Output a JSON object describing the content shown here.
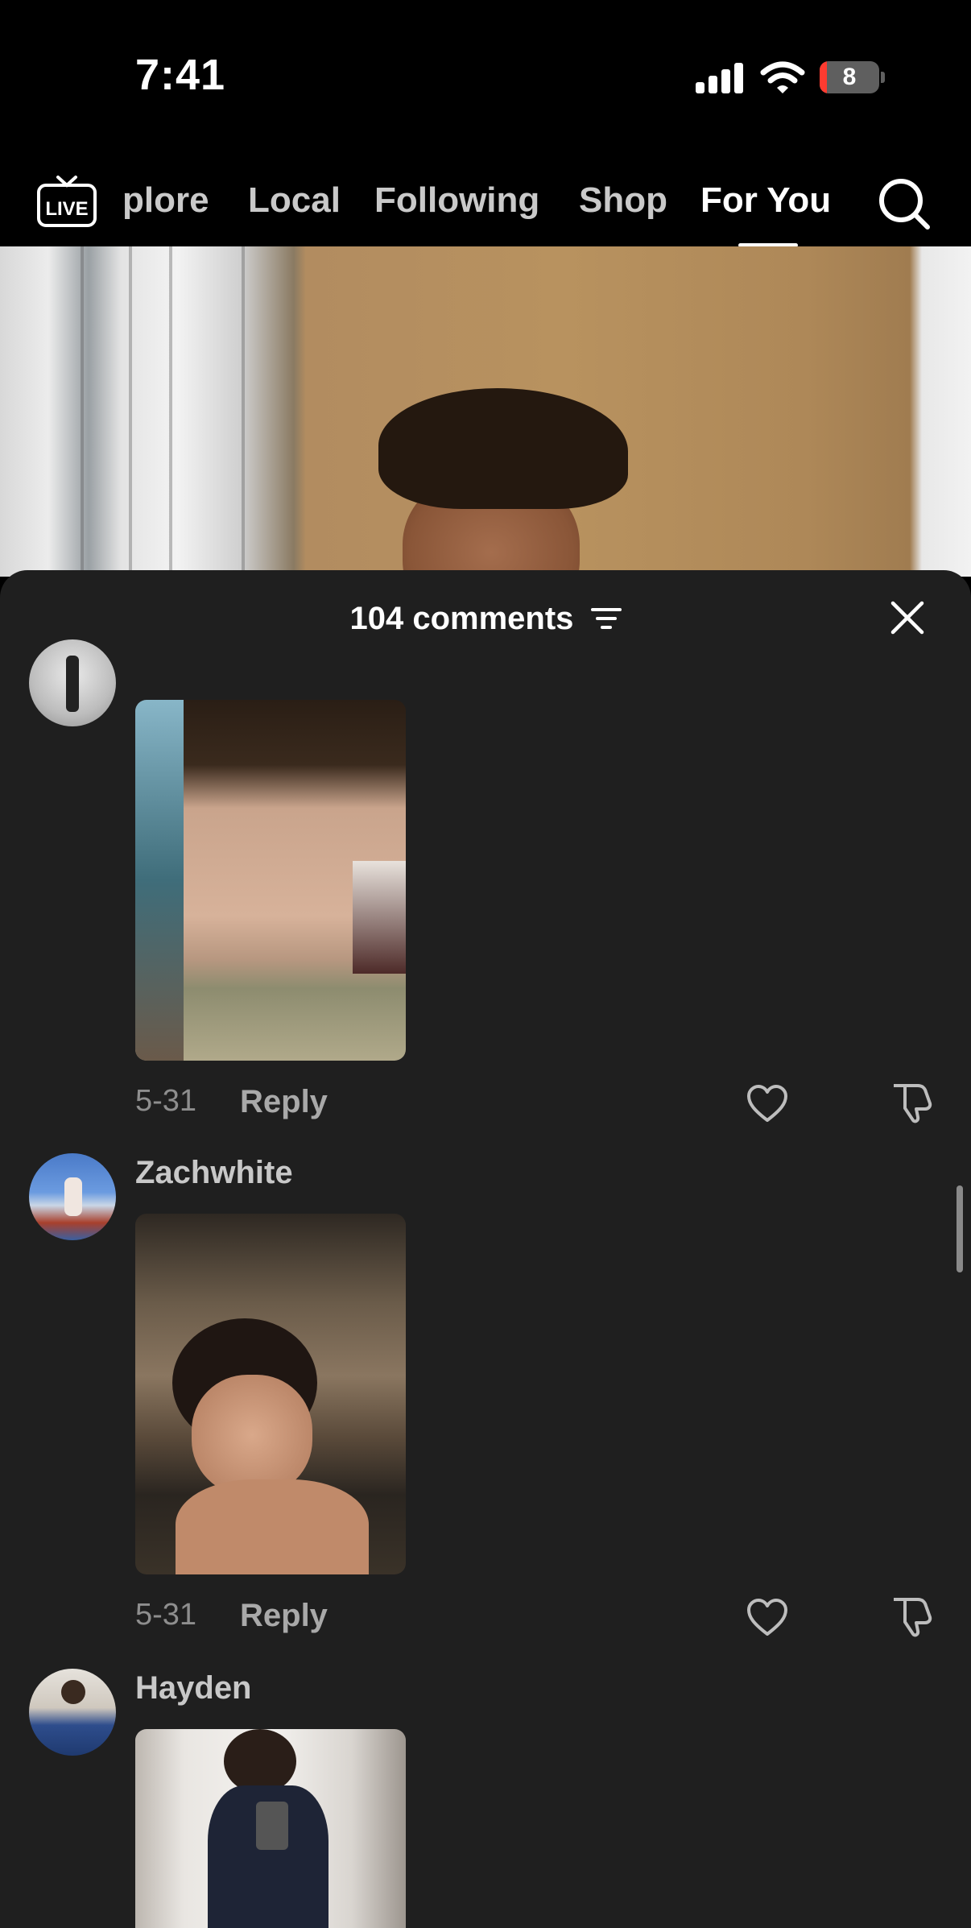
{
  "status_bar": {
    "time": "7:41",
    "battery_level": "8"
  },
  "top_nav": {
    "live_label": "LIVE",
    "tabs": [
      {
        "label": "plore",
        "active": false
      },
      {
        "label": "Local",
        "active": false
      },
      {
        "label": "Following",
        "active": false
      },
      {
        "label": "Shop",
        "active": false
      },
      {
        "label": "For You",
        "active": true
      }
    ],
    "search_icon": "search-icon"
  },
  "comments_sheet": {
    "title": "104 comments",
    "sort_icon": "sort-icon",
    "close_icon": "close-icon",
    "comments": [
      {
        "username": "",
        "date": "5-31",
        "reply_label": "Reply"
      },
      {
        "username": "Zachwhite",
        "date": "5-31",
        "reply_label": "Reply"
      },
      {
        "username": "Hayden"
      }
    ]
  },
  "colors": {
    "sheet_bg": "#1f1f1f",
    "battery_low": "#ff3b30"
  }
}
